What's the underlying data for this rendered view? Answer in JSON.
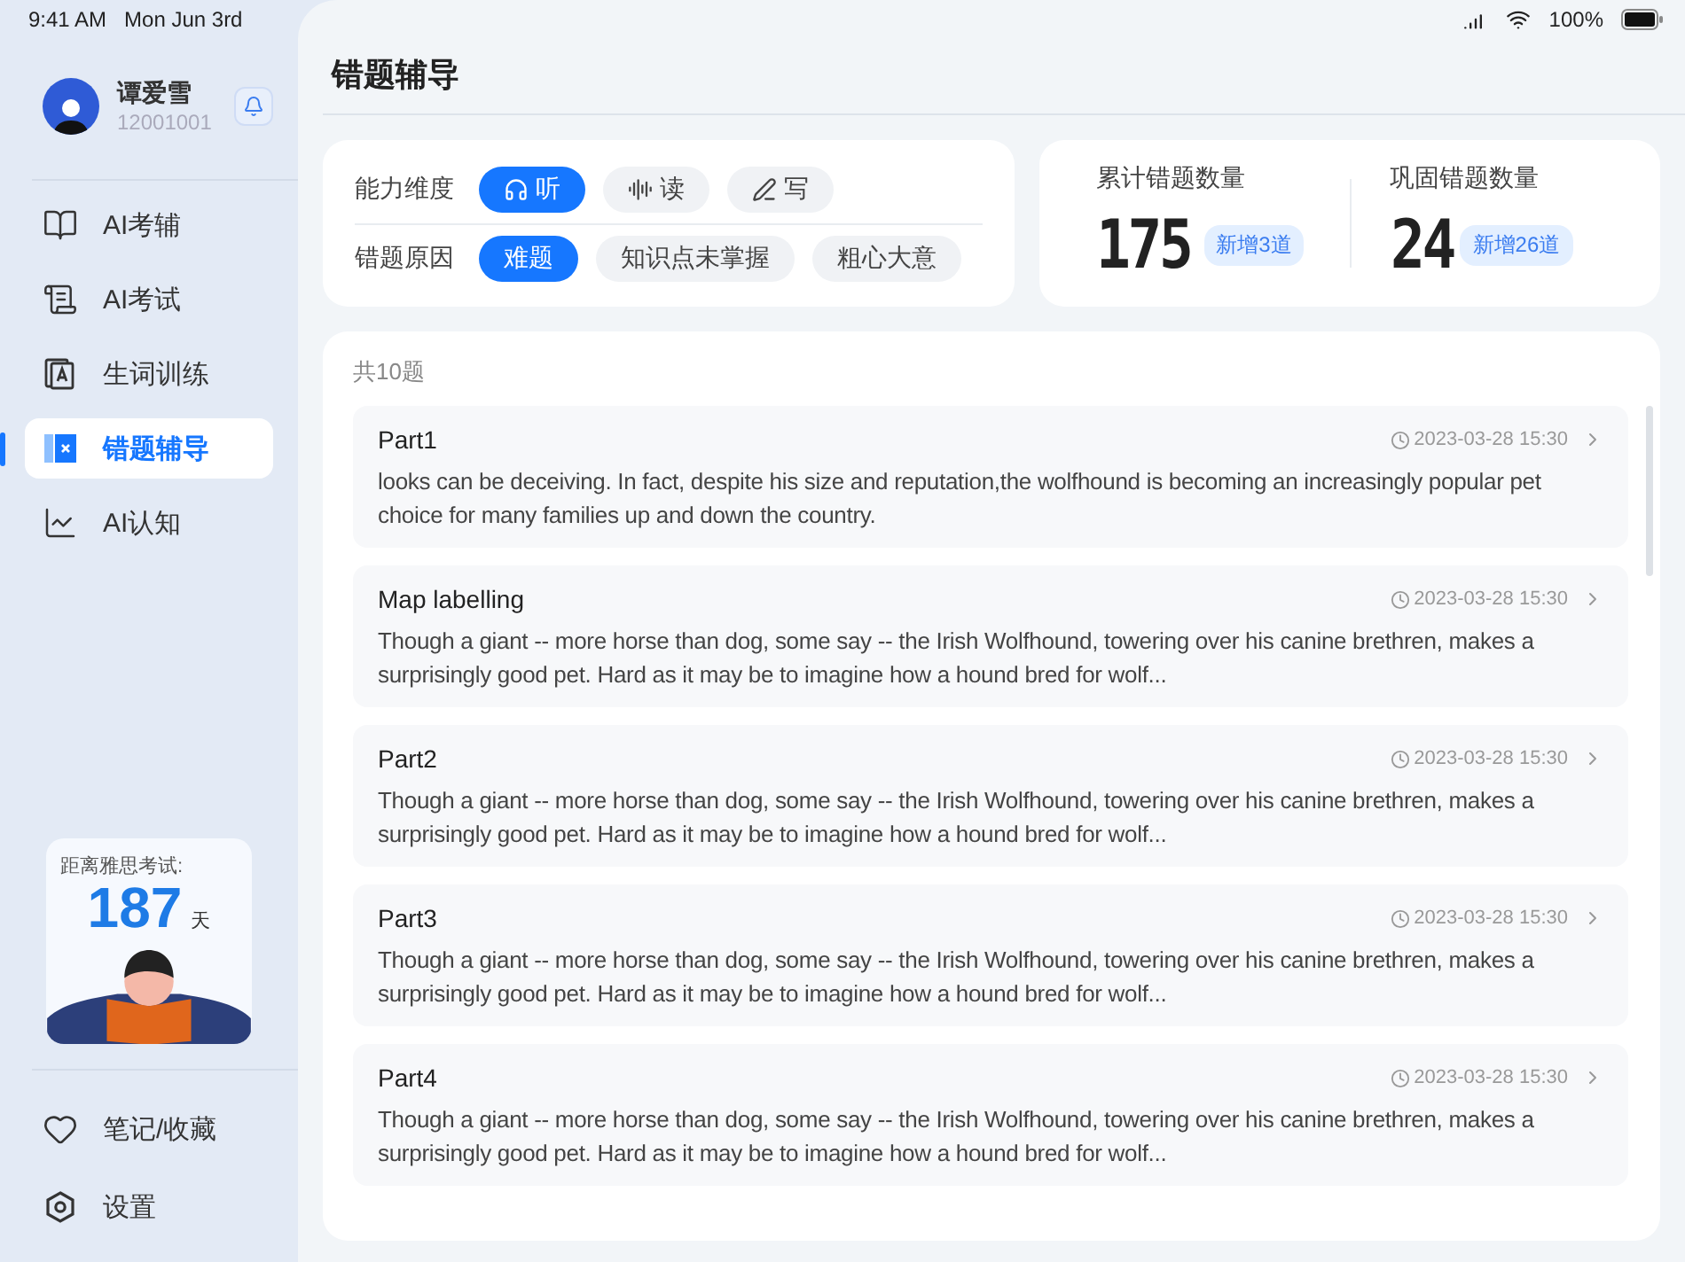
{
  "status_bar": {
    "time": "9:41 AM",
    "date": "Mon Jun 3rd",
    "battery": "100%"
  },
  "profile": {
    "name": "谭爱雪",
    "id": "12001001"
  },
  "nav": [
    {
      "label": "AI考辅",
      "selected": false
    },
    {
      "label": "AI考试",
      "selected": false
    },
    {
      "label": "生词训练",
      "selected": false
    },
    {
      "label": "错题辅导",
      "selected": true
    },
    {
      "label": "AI认知",
      "selected": false
    }
  ],
  "countdown": {
    "label": "距离雅思考试:",
    "days": "187",
    "unit": "天"
  },
  "bottom_nav": [
    {
      "label": "笔记/收藏"
    },
    {
      "label": "设置"
    }
  ],
  "page_title": "错题辅导",
  "filters": [
    {
      "label": "能力维度",
      "options": [
        {
          "label": "听",
          "selected": true
        },
        {
          "label": "读",
          "selected": false
        },
        {
          "label": "写",
          "selected": false
        }
      ]
    },
    {
      "label": "错题原因",
      "options": [
        {
          "label": "难题",
          "selected": true
        },
        {
          "label": "知识点未掌握",
          "selected": false
        },
        {
          "label": "粗心大意",
          "selected": false
        }
      ]
    }
  ],
  "stats": [
    {
      "label": "累计错题数量",
      "value": "175",
      "badge": "新增3道"
    },
    {
      "label": "巩固错题数量",
      "value": "24",
      "badge": "新增26道"
    }
  ],
  "list": {
    "count": "共10题",
    "items": [
      {
        "title": "Part1",
        "time": "2023-03-28 15:30",
        "text": "looks can be deceiving. In fact, despite his size and reputation,the wolfhound is becoming an increasingly popular pet choice for many families up and down the country."
      },
      {
        "title": "Map labelling",
        "time": "2023-03-28 15:30",
        "text": "Though a giant -- more horse than dog, some say -- the Irish Wolfhound, towering over his canine brethren, makes a surprisingly good pet. Hard as it may be to imagine how a hound bred for wolf..."
      },
      {
        "title": "Part2",
        "time": "2023-03-28 15:30",
        "text": "Though a giant -- more horse than dog, some say -- the Irish Wolfhound, towering over his canine brethren, makes a surprisingly good pet. Hard as it may be to imagine how a hound bred for wolf..."
      },
      {
        "title": "Part3",
        "time": "2023-03-28 15:30",
        "text": "Though a giant -- more horse than dog, some say -- the Irish Wolfhound, towering over his canine brethren, makes a surprisingly good pet. Hard as it may be to imagine how a hound bred for wolf..."
      },
      {
        "title": "Part4",
        "time": "2023-03-28 15:30",
        "text": "Though a giant -- more horse than dog, some say -- the Irish Wolfhound, towering over his canine brethren, makes a surprisingly good pet. Hard as it may be to imagine how a hound bred for wolf..."
      }
    ]
  }
}
